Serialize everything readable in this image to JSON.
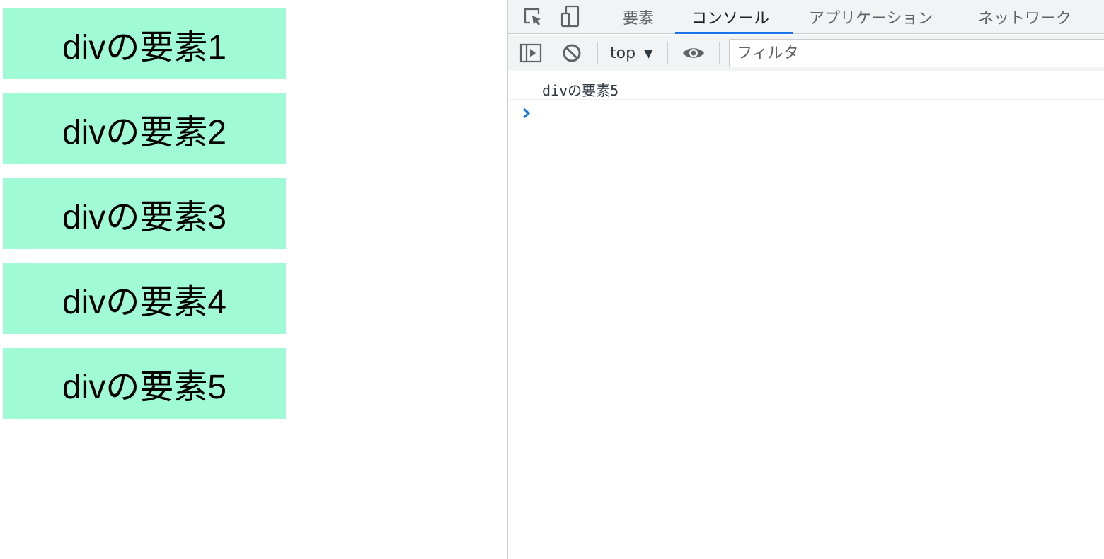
{
  "page": {
    "div_elements": [
      {
        "label": "divの要素1"
      },
      {
        "label": "divの要素2"
      },
      {
        "label": "divの要素3"
      },
      {
        "label": "divの要素4"
      },
      {
        "label": "divの要素5"
      }
    ],
    "div_background": "#a0fad6"
  },
  "devtools": {
    "icons": {
      "inspect": "inspect-element-icon",
      "device": "device-toolbar-icon",
      "sidebar": "show-sidebar-icon",
      "clear": "clear-console-icon",
      "eye": "live-expression-icon",
      "prompt": "console-prompt-chevron-icon",
      "context_dropdown": "dropdown-triangle-icon"
    },
    "tabs": [
      {
        "label": "要素",
        "active": false
      },
      {
        "label": "コンソール",
        "active": true
      },
      {
        "label": "アプリケーション",
        "active": false
      },
      {
        "label": "ネットワーク",
        "active": false
      }
    ],
    "toolbar": {
      "context": "top",
      "filter_placeholder": "フィルタ",
      "filter_value": ""
    },
    "console": {
      "messages": [
        {
          "text": "divの要素5"
        }
      ]
    },
    "accent_color": "#1a73e8"
  }
}
